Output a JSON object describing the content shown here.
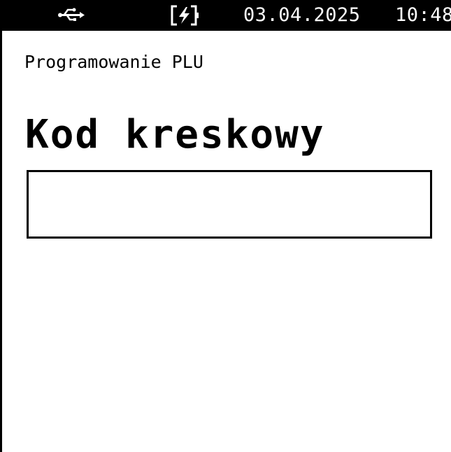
{
  "status_bar": {
    "usb_icon": "usb-icon",
    "battery_icon": "battery-charging-icon",
    "date": "03.04.2025",
    "time": "10:48"
  },
  "screen": {
    "title": "Programowanie PLU",
    "field_label": "Kod kreskowy",
    "barcode_value": ""
  },
  "colors": {
    "background": "#ffffff",
    "foreground": "#000000"
  }
}
